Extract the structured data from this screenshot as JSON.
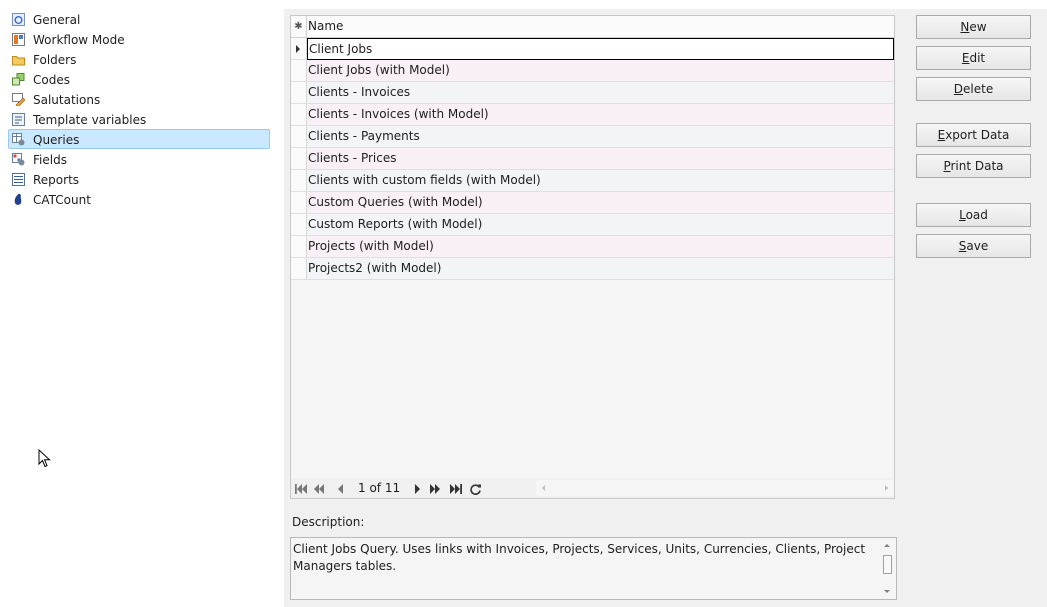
{
  "nav": {
    "items": [
      {
        "label": "General",
        "icon": "general-icon",
        "selected": false
      },
      {
        "label": "Workflow Mode",
        "icon": "workflow-icon",
        "selected": false
      },
      {
        "label": "Folders",
        "icon": "folder-icon",
        "selected": false
      },
      {
        "label": "Codes",
        "icon": "codes-icon",
        "selected": false
      },
      {
        "label": "Salutations",
        "icon": "salutations-icon",
        "selected": false
      },
      {
        "label": "Template variables",
        "icon": "template-icon",
        "selected": false
      },
      {
        "label": "Queries",
        "icon": "queries-icon",
        "selected": true
      },
      {
        "label": "Fields",
        "icon": "fields-icon",
        "selected": false
      },
      {
        "label": "Reports",
        "icon": "reports-icon",
        "selected": false
      },
      {
        "label": "CATCount",
        "icon": "catcount-icon",
        "selected": false
      }
    ]
  },
  "grid": {
    "header_indicator": "✱",
    "column": "Name",
    "rows": [
      "Client Jobs",
      "Client Jobs (with Model)",
      "Clients - Invoices",
      "Clients - Invoices (with Model)",
      "Clients - Payments",
      "Clients - Prices",
      "Clients with custom fields (with Model)",
      "Custom Queries (with Model)",
      "Custom Reports (with Model)",
      "Projects (with Model)",
      "Projects2 (with Model)"
    ],
    "current_row": 0,
    "navigator": {
      "page_text": "1 of 11"
    }
  },
  "description": {
    "label": "Description:",
    "text": "Client Jobs Query. Uses links with Invoices, Projects, Services, Units, Currencies, Clients, Project Managers tables."
  },
  "buttons": {
    "new": {
      "first": "N",
      "rest": "ew"
    },
    "edit": {
      "first": "E",
      "rest": "dit"
    },
    "delete": {
      "first": "D",
      "rest": "elete"
    },
    "export": {
      "first": "E",
      "rest": "xport Data"
    },
    "print": {
      "first": "P",
      "rest": "rint Data"
    },
    "load": {
      "first": "L",
      "rest": "oad"
    },
    "save": {
      "first": "S",
      "rest": "ave"
    }
  },
  "colors": {
    "selection": "#cce8ff",
    "panel": "#f0f0f0"
  }
}
